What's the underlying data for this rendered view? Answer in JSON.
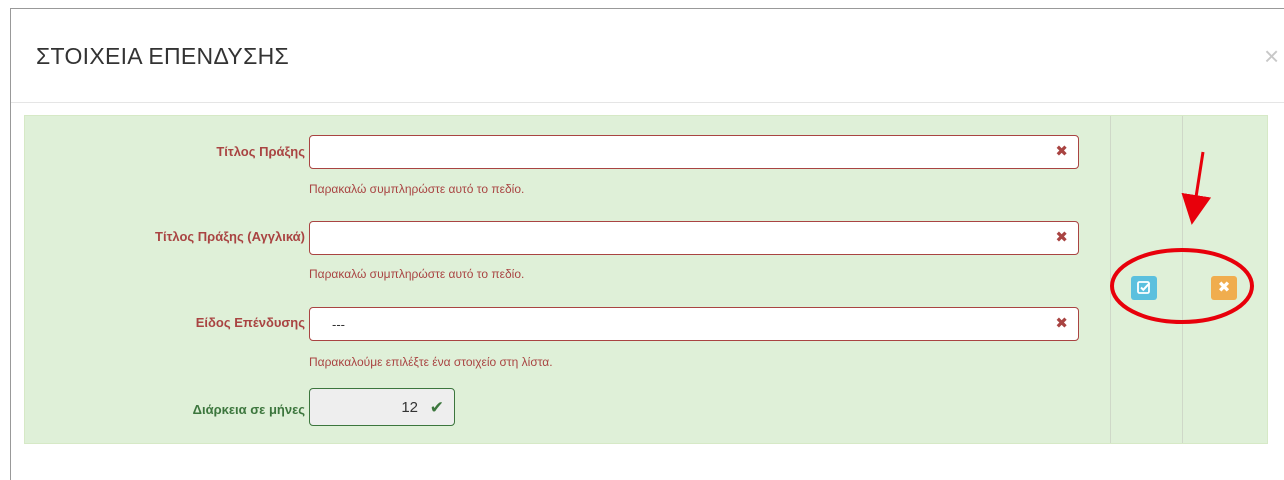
{
  "dialog": {
    "title": "ΣΤΟΙΧΕΙΑ ΕΠΕΝΔΥΣΗΣ",
    "close_icon": "close-icon",
    "close_glyph": "×"
  },
  "form": {
    "fields": [
      {
        "label": "Τίτλος Πράξης",
        "value": "",
        "error": "Παρακαλώ συμπληρώστε αυτό το πεδίο."
      },
      {
        "label": "Τίτλος Πράξης (Αγγλικά)",
        "value": "",
        "error": "Παρακαλώ συμπληρώστε αυτό το πεδίο."
      },
      {
        "label": "Είδος Επένδυσης",
        "value": "---",
        "error": "Παρακαλούμε επιλέξτε ένα στοιχείο στη λίστα."
      }
    ],
    "duration": {
      "label": "Διάρκεια σε μήνες",
      "value": "12"
    }
  },
  "actions": {
    "edit_icon": "edit-check-icon",
    "cancel_icon": "close-icon"
  },
  "annotation": {
    "color": "#e8000b"
  },
  "colors": {
    "panel_bg": "#dff0d8",
    "error": "#a94442",
    "success": "#3c763d",
    "info": "#5bc0de",
    "warning": "#f0ad4e"
  }
}
